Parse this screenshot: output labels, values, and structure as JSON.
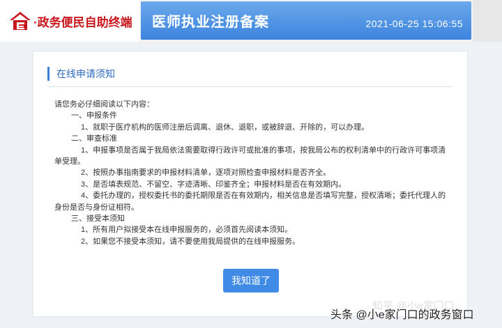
{
  "header": {
    "brand_text": "政务便民自助终端",
    "system_title": "医师执业注册备案",
    "datetime": "2021-06-25 15:06:55",
    "brand_color": "#c8161d",
    "bar_color": "#3d84de"
  },
  "notice": {
    "title": "在线申请须知",
    "intro": "请您务必仔细阅读以下内容：",
    "sections": [
      {
        "heading": "一、申报条件",
        "items": [
          "1、就职于医疗机构的医师注册后调离、退休、退职，或被辞退、开除的，可以办理。"
        ]
      },
      {
        "heading": "二、审查标准",
        "items": [
          "1、申报事项是否属于我局依法需要取得行政许可或批准的事项，按我局公布的权利清单中的行政许可事项清单受理。",
          "2、按照办事指南要求的申报材料清单，逐项对照检查申报材料是否齐全。",
          "3、是否填表规范、不留空、字迹清晰、印鉴齐全；申报材料是否在有效期内。",
          "4、委托办理的，授权委托书的委托期限是否在有效期内，相关信息是否填写完整，授权清晰；委托代理人的身份是否与身份证相符。"
        ]
      },
      {
        "heading": "三、接受本须知",
        "items": [
          "1、所有用户拟接受本在线申报服务的，必须首先阅读本须知。",
          "2、如果您不接受本须知，请不要使用我局提供的在线申报服务。"
        ]
      }
    ],
    "agree_label": "我知道了"
  },
  "watermark": {
    "text": "头条 @小e家门口的政务窗口",
    "ghost": "知乎 @小e家门口"
  }
}
